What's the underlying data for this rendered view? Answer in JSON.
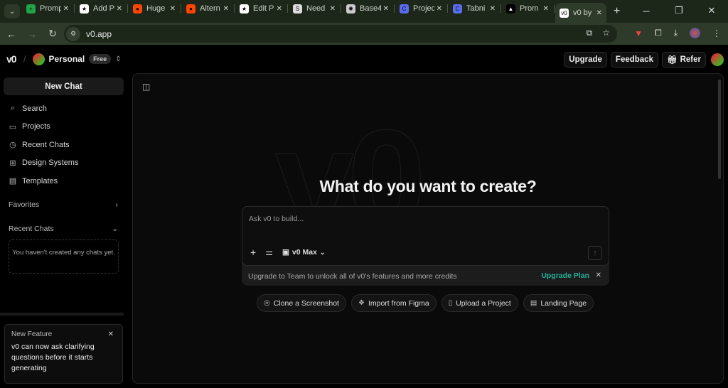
{
  "browser": {
    "tabs": [
      {
        "title": "Prompt",
        "color": "#22a348",
        "glyph": "+"
      },
      {
        "title": "Add P",
        "color": "#ffffff",
        "glyph": "★"
      },
      {
        "title": "Huge",
        "color": "#ff4500",
        "glyph": "●"
      },
      {
        "title": "Altern",
        "color": "#ff4500",
        "glyph": "●"
      },
      {
        "title": "Edit P",
        "color": "#ffffff",
        "glyph": "★"
      },
      {
        "title": "Need",
        "color": "#dddddd",
        "glyph": "S"
      },
      {
        "title": "Base4",
        "color": "#cccccc",
        "glyph": "✺"
      },
      {
        "title": "Projec",
        "color": "#5a6cf0",
        "glyph": "C"
      },
      {
        "title": "Tabni",
        "color": "#5a6cf0",
        "glyph": "C"
      },
      {
        "title": "Prom",
        "color": "#000000",
        "glyph": "▲"
      },
      {
        "title": "v0 by",
        "color": "#ffffff",
        "glyph": "v0"
      }
    ],
    "active_tab": 10,
    "url": "v0.app"
  },
  "header": {
    "logo": "v0",
    "workspace": "Personal",
    "plan_badge": "Free",
    "upgrade": "Upgrade",
    "feedback": "Feedback",
    "refer": "Refer"
  },
  "sidebar": {
    "new_chat": "New Chat",
    "items": [
      {
        "label": "Search",
        "icon": "⌕"
      },
      {
        "label": "Projects",
        "icon": "▭"
      },
      {
        "label": "Recent Chats",
        "icon": "◷"
      },
      {
        "label": "Design Systems",
        "icon": "⊞"
      },
      {
        "label": "Templates",
        "icon": "▤"
      }
    ],
    "favorites": "Favorites",
    "recent_chats": "Recent Chats",
    "empty_text": "You haven't created any chats yet.",
    "feature": {
      "title": "New Feature",
      "body": "v0 can now ask clarifying questions before it starts generating"
    }
  },
  "main": {
    "heading": "What do you want to create?",
    "placeholder": "Ask v0 to build...",
    "model": "v0 Max",
    "upgrade_text": "Upgrade to Team to unlock all of v0's features and more credits",
    "upgrade_link": "Upgrade Plan",
    "accent": "#1fb39a",
    "suggestions": [
      {
        "label": "Clone a Screenshot",
        "icon": "◎"
      },
      {
        "label": "Import from Figma",
        "icon": "❖"
      },
      {
        "label": "Upload a Project",
        "icon": "▯"
      },
      {
        "label": "Landing Page",
        "icon": "▤"
      }
    ]
  }
}
